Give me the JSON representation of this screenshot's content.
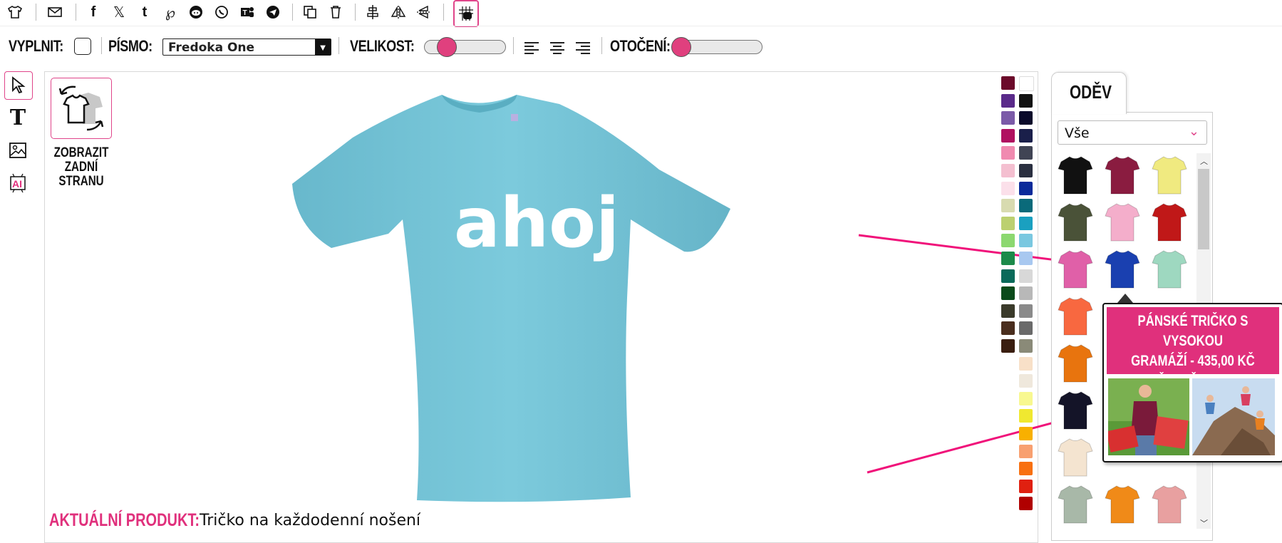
{
  "toolbar": {
    "icons": [
      "tshirt-icon",
      "mail-icon",
      "facebook-icon",
      "x-icon",
      "tumblr-icon",
      "pinterest-icon",
      "reddit-icon",
      "whatsapp-icon",
      "teams-icon",
      "telegram-icon",
      "copy-icon",
      "trash-icon",
      "align-center-icon",
      "flip-horizontal-icon",
      "flip-vertical-icon",
      "grid-icon"
    ]
  },
  "options": {
    "fill_label": "VYPLNIT:",
    "font_label": "PÍSMO:",
    "font_value": "Fredoka One",
    "size_label": "VELIKOST:",
    "rotation_label": "OTOČENÍ:"
  },
  "tools": [
    "cursor-icon",
    "text-icon",
    "image-icon",
    "ai-icon"
  ],
  "design": {
    "back_label": "ZOBRAZIT ZADNÍ STRANU",
    "shirt_color": "#74c5d8",
    "shirt_text": "ahoj"
  },
  "palette": {
    "left": [
      "#6b0a2a",
      "#5a2a8a",
      "#7b5aa8",
      "#b01060",
      "#f08ab0",
      "#f4bfd0",
      "#fbe0ea",
      "#d8dbb0",
      "#bcd070",
      "#8cd870",
      "#1c8a4a",
      "#0a6a5a",
      "#0a4a1a",
      "#3a3a2a",
      "#4a2e1e",
      "#3a1e10"
    ],
    "right": [
      "#ffffff",
      "#111111",
      "#0a0a2a",
      "#1a1f4a",
      "#404454",
      "#2a2f40",
      "#0a2a9a",
      "#0a6a7a",
      "#1aa0c0",
      "#7ac8e0",
      "#a8c8f0",
      "#d8d8d8",
      "#b8b8b8",
      "#8a8a8a",
      "#6a6a6a",
      "#8a8a78",
      "#f8e0c8",
      "#efe8dc",
      "#f8f890",
      "#f0e830",
      "#f8b000",
      "#f8a070",
      "#f87010",
      "#e02010",
      "#b00000"
    ]
  },
  "panel": {
    "tab_label": "ODĚV",
    "category_value": "Vše",
    "products": [
      "#111111",
      "#8a1c40",
      "#f0ea80",
      "#4a5238",
      "#f4aecb",
      "#c01818",
      "#e060a8",
      "#1a40b0",
      "#9ed8c0",
      "#f86840",
      "",
      "",
      "#e8740e",
      "",
      "",
      "#141428",
      "",
      "",
      "#f4e4d0",
      "",
      "",
      "#a8b8a8",
      "#f08a18",
      "#e8a0a0"
    ]
  },
  "tooltip": {
    "line1": "PÁNSKÉ TRIČKO S VYSOKOU",
    "line2": "GRAMÁŽÍ - 435,00 KČ",
    "line3": "VČETNĚ TISKU"
  },
  "current": {
    "label": "AKTUÁLNÍ PRODUKT:",
    "value": "Tričko na každodenní nošení"
  },
  "accent": "#e0307c"
}
